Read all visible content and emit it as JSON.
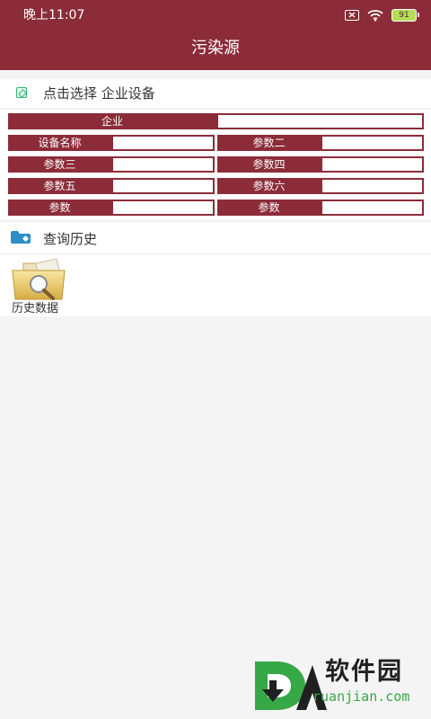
{
  "status_bar": {
    "time": "晚上11:07",
    "battery": "91"
  },
  "header": {
    "title": "污染源"
  },
  "select_section": {
    "label": "点击选择 企业设备"
  },
  "form": {
    "enterprise_label": "企业",
    "enterprise_value": "",
    "device_name_label": "设备名称",
    "device_name_value": "",
    "param2_label": "参数二",
    "param2_value": "",
    "param3_label": "参数三",
    "param3_value": "",
    "param4_label": "参数四",
    "param4_value": "",
    "param5_label": "参数五",
    "param5_value": "",
    "param6_label": "参数六",
    "param6_value": "",
    "param_a_label": "参数",
    "param_a_value": "",
    "param_b_label": "参数",
    "param_b_value": ""
  },
  "history_section": {
    "label": "查询历史",
    "item_label": "历史数据"
  },
  "watermark": {
    "main": "软件园",
    "sub": "ruanjian.com"
  },
  "colors": {
    "primary": "#8c2c39",
    "background": "#f4f4f4",
    "white": "#ffffff",
    "text": "#333333",
    "accent_green": "#2bb673",
    "accent_blue": "#2a8fc6"
  },
  "icons": {
    "sim": "sim-card-icon",
    "wifi": "wifi-icon",
    "battery": "battery-icon",
    "select": "select-icon",
    "history": "history-folder-icon",
    "history_item": "folder-search-icon",
    "logo": "d-logo-icon"
  }
}
